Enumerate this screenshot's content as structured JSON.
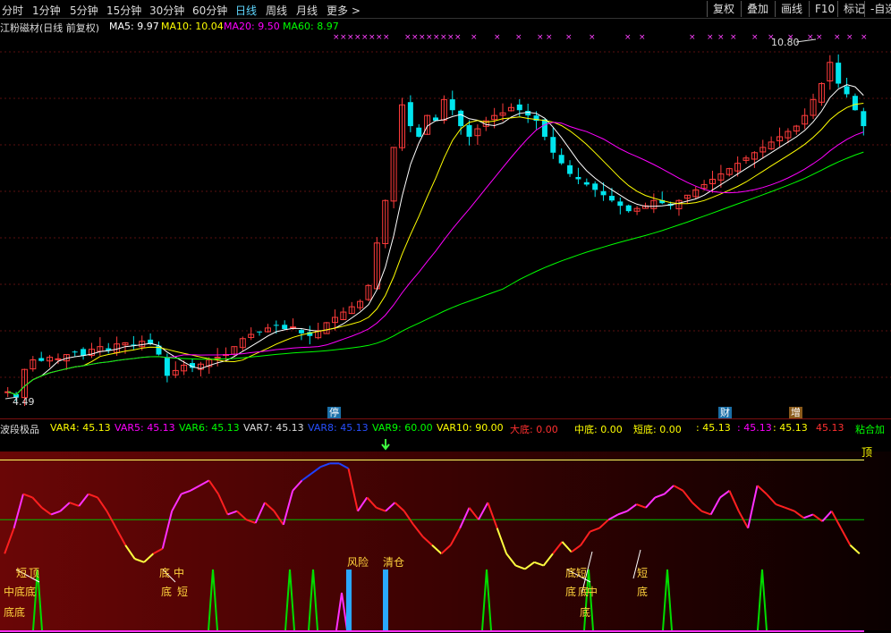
{
  "toolbar": {
    "periods": [
      "分时",
      "1分钟",
      "5分钟",
      "15分钟",
      "30分钟",
      "60分钟",
      "日线",
      "周线",
      "月线",
      "更多 >"
    ],
    "active_period": "日线",
    "buttons": [
      "复权",
      "叠加",
      "画线",
      "F10",
      "标记",
      "-自选"
    ]
  },
  "main": {
    "title": "江粉磁材(日线 前复权)",
    "ma5": "MA5: 9.97",
    "ma10": "MA10: 10.04",
    "ma20": "MA20: 9.50",
    "ma60": "MA60: 8.97",
    "high_label": "10.80",
    "low_label": "4.49",
    "flags": {
      "ting": "停",
      "cai": "财",
      "zeng": "增"
    },
    "colors": {
      "ma5": "#ffffff",
      "ma10": "#ffff00",
      "ma20": "#ff00ff",
      "ma60": "#00ff00",
      "up": "#ff3b3b",
      "down": "#00e5ee"
    }
  },
  "indicator": {
    "name": "波段极品",
    "var4": "VAR4: 45.13",
    "var5": "VAR5: 45.13",
    "var6": "VAR6: 45.13",
    "var7": "VAR7: 45.13",
    "var8": "VAR8: 45.13",
    "var9": "VAR9: 60.00",
    "var10": "VAR10: 90.00",
    "dadi": "大底: 0.00",
    "zhongdi": "中底: 0.00",
    "duandi": "短底: 0.00",
    "v1": ": 45.13",
    "v2": ": 45.13",
    "v3": ": 45.13",
    "v4": "45.13",
    "sticky": "粘合加",
    "top_label": "顶",
    "fengxian": "风险",
    "qingcang": "清仓",
    "signals": [
      "短",
      "顶",
      "中",
      "底",
      "底",
      "底",
      "底",
      "中",
      "底",
      "短",
      "底",
      "底",
      "短",
      "中",
      "底",
      "底",
      "底",
      "短",
      "底"
    ]
  },
  "chart_data": {
    "type": "line",
    "price_series": {
      "name": "close",
      "values": [
        4.6,
        4.49,
        5.02,
        5.2,
        5.18,
        5.25,
        5.22,
        5.3,
        5.35,
        5.28,
        5.4,
        5.45,
        5.38,
        5.5,
        5.52,
        5.48,
        5.55,
        5.5,
        5.3,
        4.9,
        5.0,
        5.1,
        5.05,
        5.12,
        5.2,
        5.25,
        5.3,
        5.45,
        5.6,
        5.68,
        5.72,
        5.8,
        5.85,
        5.78,
        5.82,
        5.7,
        5.65,
        5.75,
        5.9,
        6.0,
        6.1,
        6.2,
        6.3,
        6.6,
        7.4,
        8.2,
        9.2,
        10.0,
        9.6,
        9.4,
        9.8,
        9.7,
        10.1,
        9.9,
        9.6,
        9.4,
        9.55,
        9.7,
        9.8,
        9.85,
        9.95,
        9.9,
        9.8,
        9.7,
        9.4,
        9.1,
        8.9,
        8.7,
        8.6,
        8.5,
        8.4,
        8.3,
        8.2,
        8.1,
        8.0,
        8.05,
        8.1,
        8.2,
        8.15,
        8.1,
        8.2,
        8.3,
        8.4,
        8.5,
        8.6,
        8.7,
        8.8,
        8.9,
        9.0,
        9.1,
        9.2,
        9.3,
        9.4,
        9.5,
        9.6,
        9.8,
        10.1,
        10.4,
        10.8,
        10.4,
        10.2,
        9.9,
        9.6
      ]
    },
    "ma_series": [
      {
        "name": "MA5",
        "color": "#ffffff"
      },
      {
        "name": "MA10",
        "color": "#ffff00"
      },
      {
        "name": "MA20",
        "color": "#ff00ff"
      },
      {
        "name": "MA60",
        "color": "#00ff00"
      }
    ],
    "ylim": [
      4.3,
      11.2
    ],
    "indicator_series": {
      "values": [
        45,
        60,
        80,
        78,
        72,
        68,
        70,
        75,
        73,
        80,
        78,
        70,
        60,
        50,
        42,
        40,
        45,
        48,
        70,
        80,
        82,
        85,
        88,
        80,
        68,
        70,
        65,
        63,
        75,
        70,
        62,
        82,
        88,
        92,
        96,
        98,
        98,
        95,
        70,
        78,
        72,
        70,
        75,
        70,
        62,
        55,
        50,
        45,
        50,
        60,
        72,
        65,
        75,
        60,
        45,
        38,
        36,
        40,
        38,
        45,
        52,
        46,
        50,
        58,
        60,
        65,
        68,
        70,
        74,
        72,
        78,
        80,
        85,
        82,
        75,
        70,
        68,
        78,
        82,
        70,
        60,
        85,
        80,
        74,
        72,
        70,
        66,
        68,
        64,
        70,
        60,
        50,
        45
      ],
      "ylim": [
        0,
        105
      ],
      "levels": [
        {
          "name": "顶",
          "value": 100
        },
        {
          "name": "mid",
          "value": 65
        }
      ]
    }
  }
}
